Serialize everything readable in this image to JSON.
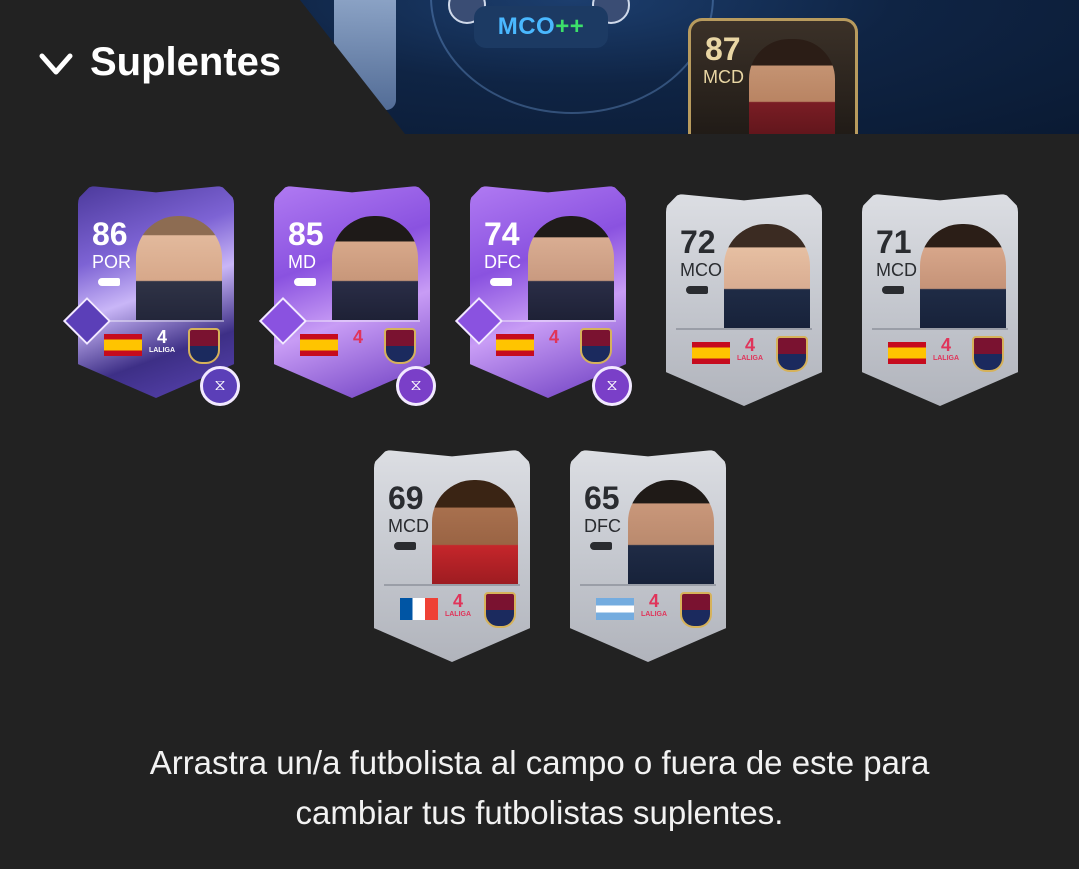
{
  "header": {
    "title": "Suplentes"
  },
  "pitch": {
    "position_pill": {
      "code": "MCO",
      "plus": "++"
    },
    "featured_card": {
      "rating": "87",
      "position": "MCD"
    }
  },
  "bench": [
    {
      "rating": "86",
      "position": "POR",
      "variant": "special",
      "nation": "spain",
      "league_mark": "4",
      "league_text": "LALIGA"
    },
    {
      "rating": "85",
      "position": "MD",
      "variant": "purple",
      "nation": "spain",
      "league_mark": "4",
      "league_text": ""
    },
    {
      "rating": "74",
      "position": "DFC",
      "variant": "purple",
      "nation": "spain",
      "league_mark": "4",
      "league_text": ""
    },
    {
      "rating": "72",
      "position": "MCO",
      "variant": "silver",
      "nation": "spain",
      "league_mark": "4",
      "league_text": "LALIGA"
    },
    {
      "rating": "71",
      "position": "MCD",
      "variant": "silver",
      "nation": "spain",
      "league_mark": "4",
      "league_text": "LALIGA"
    },
    {
      "rating": "69",
      "position": "MCD",
      "variant": "silver",
      "nation": "france",
      "league_mark": "4",
      "league_text": "LALIGA"
    },
    {
      "rating": "65",
      "position": "DFC",
      "variant": "silver",
      "nation": "argentina",
      "league_mark": "4",
      "league_text": "LALIGA"
    }
  ],
  "hint": {
    "line1": "Arrastra un/a futbolista al campo o fuera de este para",
    "line2": "cambiar tus futbolistas suplentes."
  },
  "icons": {
    "collapse": "chevron-down-icon",
    "evolution": "dna-icon",
    "playstyle": "playstyle-diamond-icon",
    "boot": "boot-icon",
    "club": "levante-crest-icon"
  },
  "colors": {
    "background": "#222222",
    "pitch": "#0f2444",
    "pill_blue": "#4ab8ff",
    "pill_green": "#3ce06a",
    "silver_card": "#c3c6cd",
    "purple_card": "#8a52e0"
  }
}
